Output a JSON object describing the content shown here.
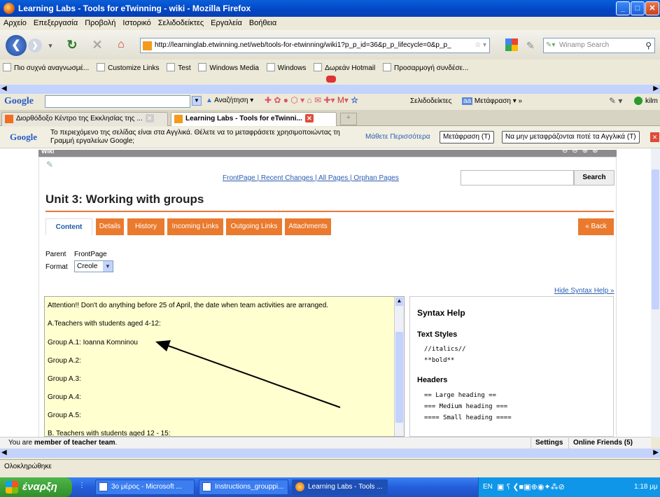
{
  "window": {
    "title": "Learning Labs - Tools for eTwinning - wiki - Mozilla Firefox"
  },
  "menu": [
    "Αρχείο",
    "Επεξεργασία",
    "Προβολή",
    "Ιστορικό",
    "Σελιδοδείκτες",
    "Εργαλεία",
    "Βοήθεια"
  ],
  "nav": {
    "url": "http://learninglab.etwinning.net/web/tools-for-etwinning/wiki1?p_p_id=36&p_p_lifecycle=0&p_p_",
    "search_placeholder": "Winamp Search"
  },
  "bookmarks": [
    "Πιο συχνά αναγνωσμέ...",
    "Customize Links",
    "Test",
    "Windows Media",
    "Windows",
    "Δωρεάν Hotmail",
    "Προσαρμογή συνδέσε..."
  ],
  "googlebar": {
    "logo": "Google",
    "search_label": "Αναζήτηση",
    "bookmarks_label": "Σελιδοδείκτες",
    "translate_label": "Μετάφραση",
    "account": "kilm"
  },
  "tabs": [
    {
      "label": "Διορθόδοξο Κέντρο της Εκκλησίας της ...",
      "active": false
    },
    {
      "label": "Learning Labs - Tools for eTwinni...",
      "active": true
    }
  ],
  "translate": {
    "message_line1": "Το περιεχόμενο της σελίδας είναι στα Αγγλικά. Θέλετε να το μεταφράσετε χρησιμοποιώντας τη",
    "message_line2": "Γραμμή εργαλείων Google;",
    "learn_more": "Μάθετε Περισσότερα",
    "translate_btn": "Μετάφραση (T)",
    "never_btn": "Να μην μεταφράζονται ποτέ τα Αγγλικά (T)"
  },
  "wiki": {
    "header": "Wiki",
    "links": "FrontPage | Recent Changes | All Pages | Orphan Pages",
    "search_btn": "Search",
    "title": "Unit 3: Working with groups",
    "tabs": [
      "Content",
      "Details",
      "History",
      "Incoming Links",
      "Outgoing Links",
      "Attachments"
    ],
    "back": "« Back",
    "parent_label": "Parent",
    "parent_value": "FrontPage",
    "format_label": "Format",
    "format_value": "Creole",
    "hide_syntax": "Hide Syntax Help »",
    "editor_lines": [
      "Attention!! Don't do anything before 25 of April, the date when team activities are arranged.",
      "A.Teachers with students aged 4-12:",
      "Group A.1:  Ioanna Komninou",
      "Group A.2:",
      "Group A.3:",
      "Group A.4:",
      "Group A.5:",
      "B. Teachers with students aged 12 - 15:"
    ],
    "syntax": {
      "title": "Syntax Help",
      "text_styles": "Text Styles",
      "italics": "//italics//",
      "bold": "**bold**",
      "headers": "Headers",
      "large": "== Large heading ==",
      "medium": "=== Medium heading ===",
      "small": "==== Small heading ===="
    }
  },
  "friends": {
    "status_prefix": "You are ",
    "status_role": "member of teacher team",
    "status_suffix": ".",
    "settings": "Settings",
    "online": "Online Friends (5)"
  },
  "status": "Ολοκληρώθηκε",
  "taskbar": {
    "start": "έναρξη",
    "tasks": [
      "3ο μέρος - Microsoft ...",
      "Instructions_grouppi...",
      "Learning Labs - Tools ..."
    ],
    "lang": "EN",
    "time": "1:18 μμ"
  }
}
